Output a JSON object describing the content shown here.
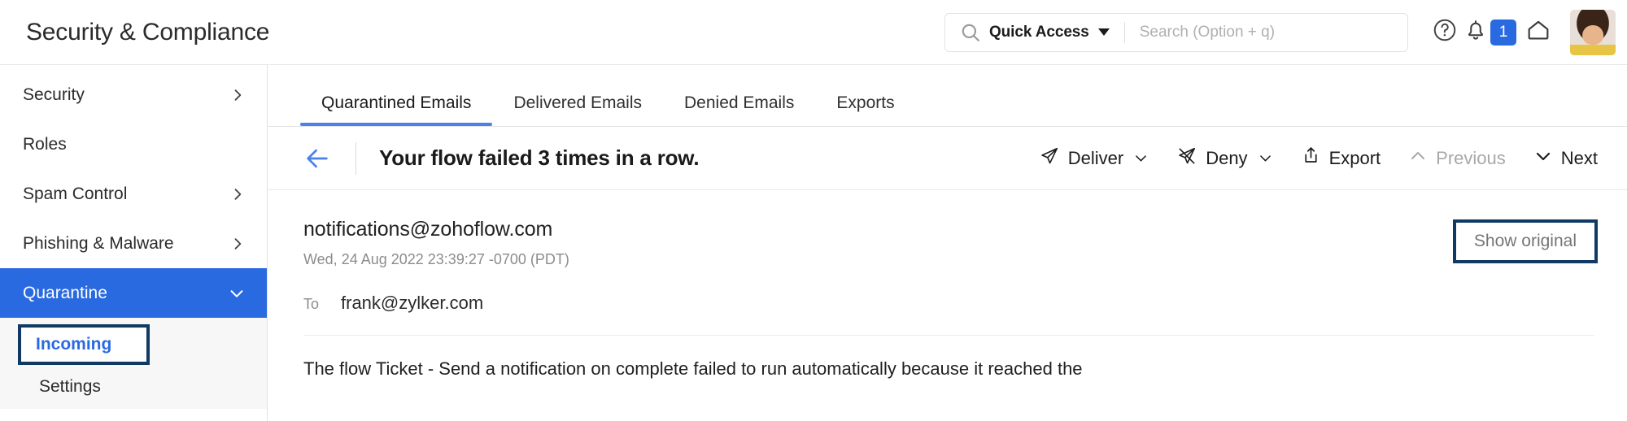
{
  "header": {
    "app_title": "Security & Compliance",
    "search": {
      "scope_label": "Quick Access",
      "placeholder": "Search (Option + q)",
      "value": ""
    },
    "help_icon": "question-circle-icon",
    "notification_count": "1",
    "home_icon": "home-icon",
    "avatar_alt": "user-avatar"
  },
  "sidebar": {
    "items": [
      {
        "label": "Security",
        "has_chevron": true,
        "active": false
      },
      {
        "label": "Roles",
        "has_chevron": false,
        "active": false
      },
      {
        "label": "Spam Control",
        "has_chevron": true,
        "active": false
      },
      {
        "label": "Phishing & Malware",
        "has_chevron": true,
        "active": false
      },
      {
        "label": "Quarantine",
        "has_chevron": true,
        "active": true
      }
    ],
    "subitems": [
      {
        "label": "Incoming",
        "selected": true
      },
      {
        "label": "Settings",
        "selected": false
      }
    ]
  },
  "tabs": [
    {
      "label": "Quarantined Emails",
      "active": true
    },
    {
      "label": "Delivered Emails",
      "active": false
    },
    {
      "label": "Denied Emails",
      "active": false
    },
    {
      "label": "Exports",
      "active": false
    }
  ],
  "actionbar": {
    "back_label": "",
    "subject": "Your flow failed 3 times in a row.",
    "actions": [
      {
        "label": "Deliver",
        "icon": "paper-plane-icon",
        "dropdown": true,
        "disabled": false
      },
      {
        "label": "Deny",
        "icon": "paper-plane-slash-icon",
        "dropdown": true,
        "disabled": false
      },
      {
        "label": "Export",
        "icon": "export-upload-icon",
        "dropdown": false,
        "disabled": false
      },
      {
        "label": "Previous",
        "icon": "chevron-up-icon",
        "dropdown": false,
        "disabled": true
      },
      {
        "label": "Next",
        "icon": "chevron-down-icon",
        "dropdown": false,
        "disabled": false
      }
    ]
  },
  "email": {
    "sender": "notifications@zohoflow.com",
    "date": "Wed, 24 Aug 2022 23:39:27 -0700 (PDT)",
    "to_label": "To",
    "to_value": "frank@zylker.com",
    "show_original_label": "Show original",
    "body_preview": "The flow Ticket - Send a notification on complete failed to run automatically because it reached the"
  },
  "colors": {
    "accent_blue": "#2a6ae0",
    "tab_underline": "#4a82e8",
    "highlight_box": "#103a63",
    "badge_blue": "#2a6ae0"
  }
}
